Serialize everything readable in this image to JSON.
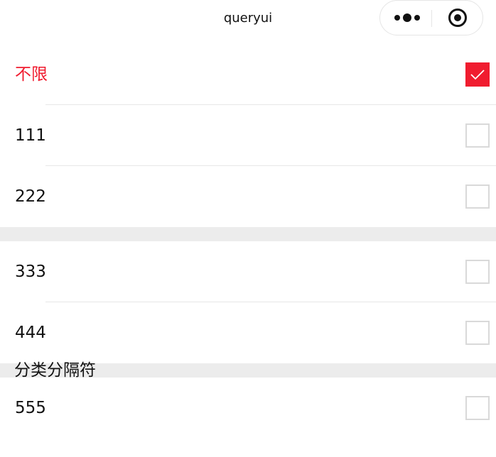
{
  "navbar": {
    "title": "queryui",
    "more_icon": "more-dots-icon",
    "close_icon": "target-icon"
  },
  "colors": {
    "accent": "#f01c2f",
    "checkbox_border": "#d9d9d9",
    "divider": "#e7e7e7",
    "section_bg": "#ececec",
    "text": "#111111"
  },
  "list": {
    "items": [
      {
        "label": "不限",
        "checked": true
      },
      {
        "label": "111",
        "checked": false
      },
      {
        "label": "222",
        "checked": false
      },
      {
        "label": "333",
        "checked": false
      },
      {
        "label": "444",
        "checked": false
      },
      {
        "label": "555",
        "checked": false
      }
    ],
    "separator_label": "分类分隔符"
  }
}
